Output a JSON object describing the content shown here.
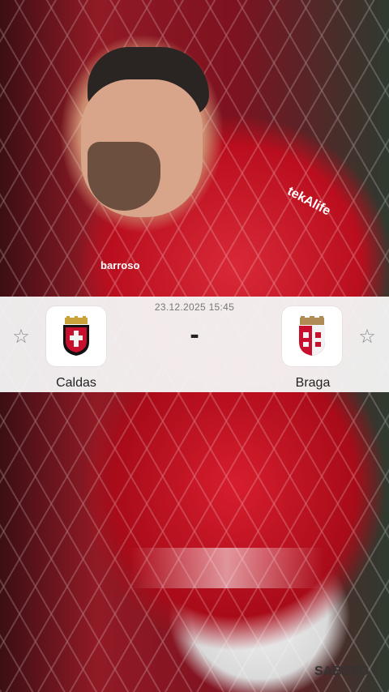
{
  "match": {
    "datetime": "23.12.2025 15:45",
    "score_separator": "-",
    "home_team": {
      "name": "Caldas",
      "logo": "caldas-crest-icon"
    },
    "away_team": {
      "name": "Braga",
      "logo": "braga-crest-icon"
    }
  },
  "icons": {
    "favorite_home": "star-outline-icon",
    "favorite_away": "star-outline-icon"
  },
  "background": {
    "jersey_sponsor": "tekAlife",
    "jersey_brand": "barroso",
    "shorts_sponsor": "SABSEG"
  },
  "colors": {
    "card_bg": "#f4f4f4",
    "text_primary": "#222222",
    "text_secondary": "#777777",
    "braga_red": "#c8102e"
  }
}
